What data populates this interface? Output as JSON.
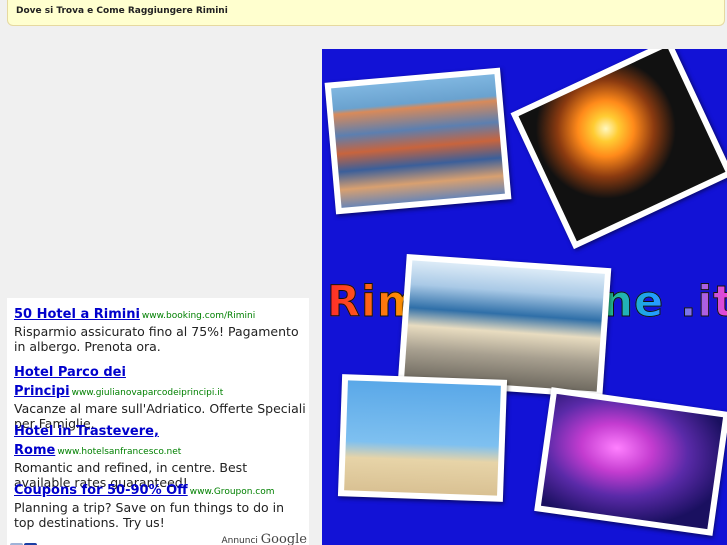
{
  "header": {
    "title": "Dove si Trova e Come Raggiungere Rimini"
  },
  "ads": [
    {
      "headline": "50 Hotel a Rimini",
      "url": "www.booking.com/Rimini",
      "desc": "Risparmio assicurato fino al 75%! Pagamento in albergo. Prenota ora."
    },
    {
      "headline": "Hotel Parco dei Principi",
      "url": "www.giulianovaparcodeiprincipi.it",
      "desc": "Vacanze al mare sull'Adriatico. Offerte Speciali per Famiglie."
    },
    {
      "headline": "Hotel in Trastevere, Rome",
      "url": "www.hotelsanfrancesco.net",
      "desc": "Romantic and refined, in centre. Best available rates guaranteed!"
    },
    {
      "headline": "Coupons for 50-90% Off",
      "url": "www.Groupon.com",
      "desc": "Planning a trip? Save on fun things to do in top destinations. Try us!"
    }
  ],
  "adfooter": {
    "prev": "‹",
    "next": "›",
    "label": "Annunci",
    "brand": "Google"
  },
  "hero": {
    "logo_text": "Rimini Online .it",
    "background": "#1212d6"
  }
}
